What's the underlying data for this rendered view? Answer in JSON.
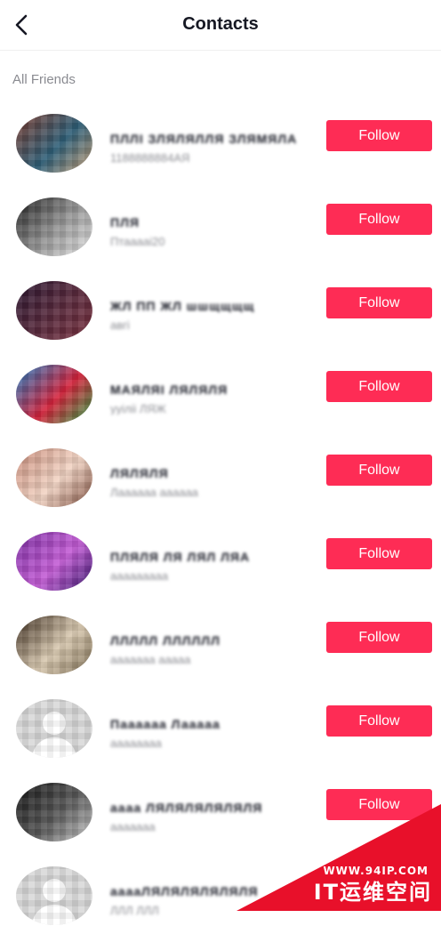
{
  "header": {
    "title": "Contacts",
    "back_icon": "chevron-left-icon"
  },
  "section": {
    "label": "All Friends"
  },
  "colors": {
    "accent": "#fe2c55",
    "text_primary": "#161823",
    "text_secondary": "#8a8b91"
  },
  "contacts": [
    {
      "name": "ПЛЛІ ЗЛЯЛЯЛЛЯ ЗЛЯМЯЛА",
      "subtitle": "1188888884АЯ",
      "avatar_colors": [
        "#7a3b2e",
        "#2e5f78",
        "#c9a27a"
      ],
      "follow_label": "Follow"
    },
    {
      "name": "ПЛЯ",
      "subtitle": "Птааааі20",
      "avatar_colors": [
        "#1c1c1c",
        "#9a9a9a",
        "#e8e8e8"
      ],
      "follow_label": "Follow"
    },
    {
      "name": "ЖЛ ПП ЖЛ шшщщщщ",
      "subtitle": "авгі",
      "avatar_colors": [
        "#2a1730",
        "#5b2a3d",
        "#7a3340"
      ],
      "follow_label": "Follow"
    },
    {
      "name": "МАЯЛЯІ ЛЯЛЯЛЯ",
      "subtitle": "ууіліі ЛЯЖ",
      "avatar_colors": [
        "#1a7fc4",
        "#d6223b",
        "#2ea84a"
      ],
      "follow_label": "Follow"
    },
    {
      "name": "ЛЯЛЯЛЯ",
      "subtitle": "Лаааааа аааааа",
      "avatar_colors": [
        "#c98c7a",
        "#f2d4c4",
        "#7a4a3a"
      ],
      "follow_label": "Follow"
    },
    {
      "name": "ПЛЯЛЯ ЛЯ ЛЯЛ ЛЯА",
      "subtitle": "ааааааааа",
      "avatar_colors": [
        "#7d2fa3",
        "#c45cd6",
        "#3b1a6e"
      ],
      "follow_label": "Follow"
    },
    {
      "name": "ЛЛЛЛЛ ЛЛЛЛЛЛ",
      "subtitle": "ааааааа ааааа",
      "avatar_colors": [
        "#3a2a1c",
        "#d9c9b0",
        "#7a6a50"
      ],
      "follow_label": "Follow"
    },
    {
      "name": "Паааааа Лааааа",
      "subtitle": "аааааааа",
      "avatar_colors": [
        "#d9d9d9",
        "#cccccc",
        "#e6e6e6"
      ],
      "follow_label": "Follow",
      "default_avatar": true
    },
    {
      "name": "аааа ЛЯЛЯЛЯЛЯЛЯЛЯ",
      "subtitle": "ааааааа",
      "avatar_colors": [
        "#111111",
        "#5a5a5a",
        "#d0d0d0"
      ],
      "follow_label": "Follow"
    },
    {
      "name": "ааааЛЯЛЯЛЯЛЯЛЯЛЯ",
      "subtitle": "ЛЛЛ ЛЛЛ",
      "avatar_colors": [
        "#d9d9d9",
        "#cccccc",
        "#e6e6e6"
      ],
      "follow_label": "Follow",
      "default_avatar": true
    }
  ],
  "watermark": {
    "url": "WWW.94IP.COM",
    "name": "IT运维空间"
  }
}
